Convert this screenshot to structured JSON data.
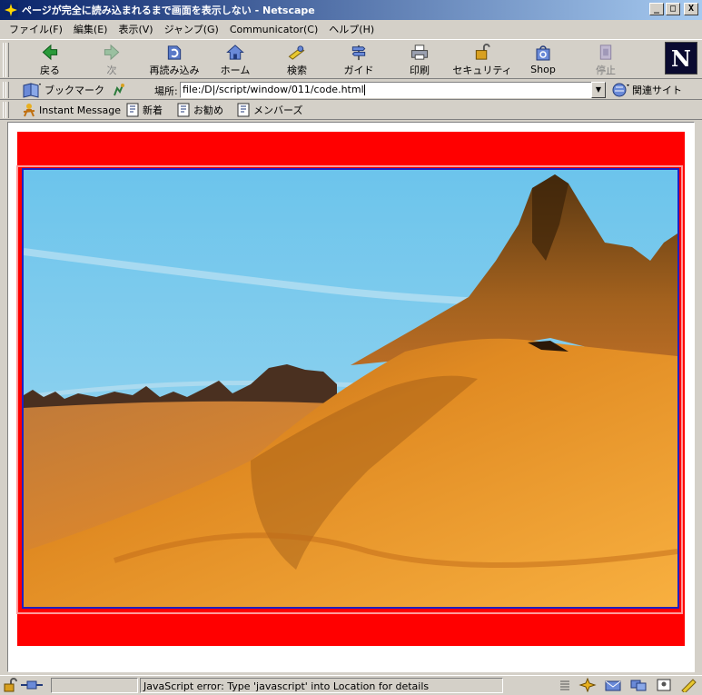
{
  "window": {
    "title": "ページが完全に読み込まれるまで画面を表示しない - Netscape",
    "controls": [
      "_",
      "□",
      "X"
    ]
  },
  "menu": [
    "ファイル(F)",
    "編集(E)",
    "表示(V)",
    "ジャンプ(G)",
    "Communicator(C)",
    "ヘルプ(H)"
  ],
  "toolbar": {
    "back": "戻る",
    "forward": "次",
    "reload": "再読み込み",
    "home": "ホーム",
    "search": "検索",
    "guide": "ガイド",
    "print": "印刷",
    "security": "セキュリティ",
    "shop": "Shop",
    "stop": "停止",
    "logo": "N"
  },
  "location": {
    "bookmarks_label": "ブックマーク",
    "label": "場所:",
    "url": "file:/D|/script/window/011/code.html",
    "related_label": "関連サイト"
  },
  "personal_toolbar": {
    "instant_message": "Instant Message",
    "new": "新着",
    "recommend": "お勧め",
    "members": "メンバーズ"
  },
  "status": {
    "text": "JavaScript error: Type 'javascript' into Location for details"
  },
  "colors": {
    "titlebar_start": "#0a246a",
    "titlebar_end": "#a6caf0",
    "page_red": "#ff0000",
    "image_border": "#2020c0"
  }
}
